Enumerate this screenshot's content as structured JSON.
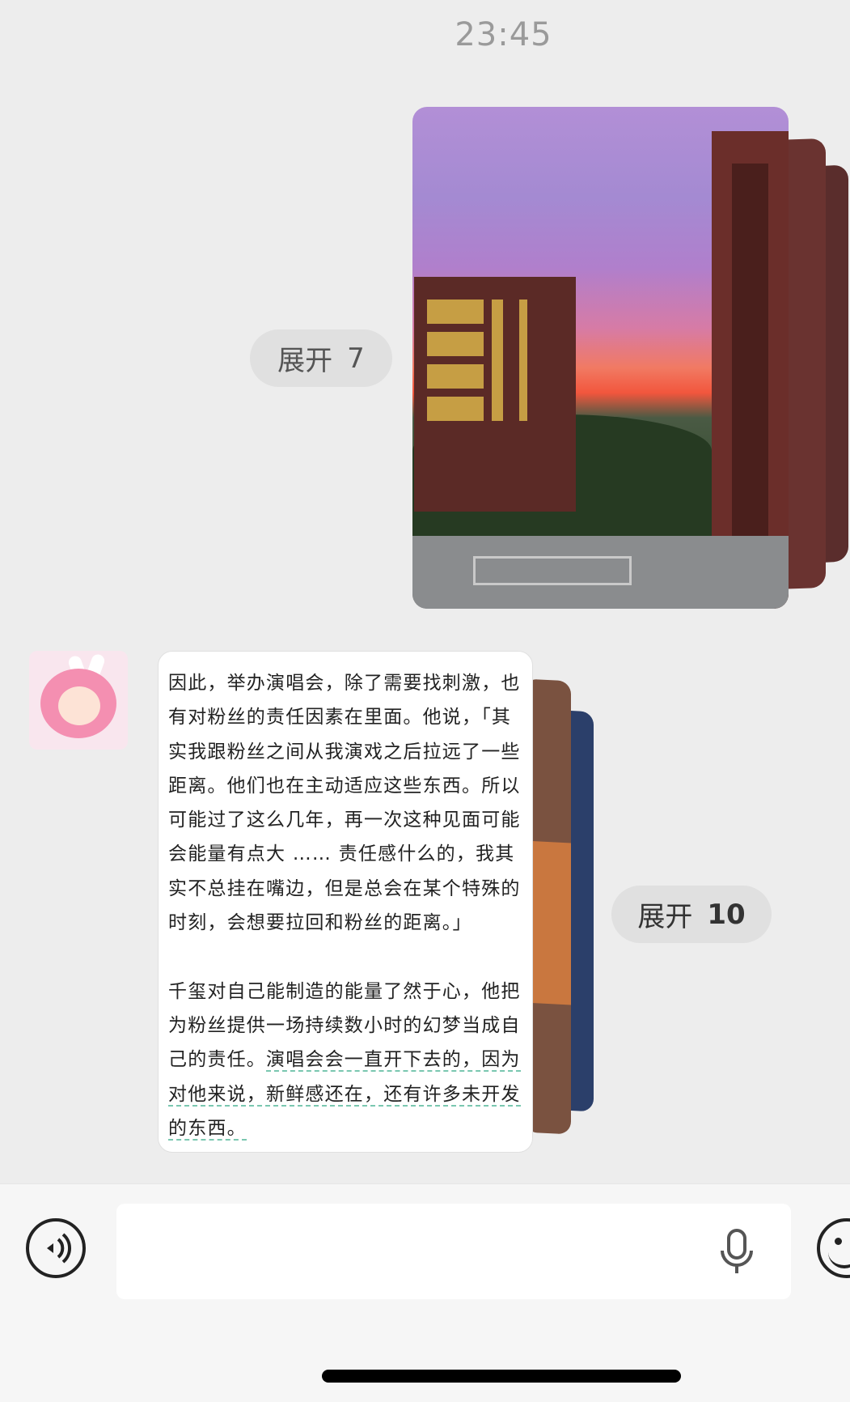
{
  "conversation": {
    "timestamp": "23:45",
    "expand_photos": {
      "label": "展开",
      "count": "7"
    },
    "expand_cards": {
      "label": "展开",
      "count": "10"
    },
    "message": {
      "text_plain": "因此，举办演唱会，除了需要找刺激，也有对粉丝的责任因素在里面。他说，「其实我跟粉丝之间从我演戏之后拉远了一些距离。他们也在主动适应这些东西。所以可能过了这么几年，再一次这种见面可能会能量有点大 …… 责任感什么的，我其实不总挂在嘴边，但是总会在某个特殊的时刻，会想要拉回和粉丝的距离。」\n\n千玺对自己能制造的能量了然于心，他把为粉丝提供一场持续数小时的幻梦当成自己的责任。",
      "text_linked": "演唱会会一直开下去的，因为对他来说，新鲜感还在，还有许多未开发的东西。"
    }
  },
  "input_bar": {
    "text_value": "",
    "icons": {
      "voice": "voice-mode-icon",
      "mic": "microphone-icon",
      "emoji": "emoji-icon"
    }
  },
  "colors": {
    "background": "#ededed",
    "bubble": "#ffffff",
    "pill": "#e0e0e0",
    "link_underline": "#7ac7b0"
  }
}
